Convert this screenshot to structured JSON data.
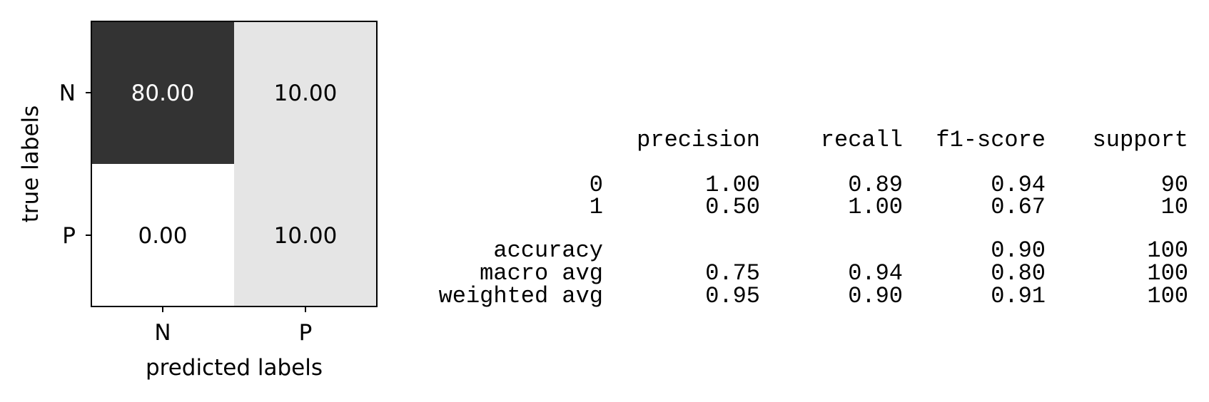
{
  "chart_data": [
    {
      "type": "heatmap",
      "title": "",
      "xlabel": "predicted labels",
      "ylabel": "true labels",
      "x_categories": [
        "N",
        "P"
      ],
      "y_categories": [
        "N",
        "P"
      ],
      "values": [
        [
          80.0,
          10.0
        ],
        [
          0.0,
          10.0
        ]
      ],
      "value_labels": [
        [
          "80.00",
          "10.00"
        ],
        [
          "0.00",
          "10.00"
        ]
      ],
      "colormap": "greys",
      "colors": {
        "dark": "#333333",
        "light": "#e5e5e5",
        "white": "#ffffff",
        "text_on_dark": "#ffffff",
        "text_on_light": "#000000"
      }
    },
    {
      "type": "table",
      "columns": [
        "precision",
        "recall",
        "f1-score",
        "support"
      ],
      "rows": [
        {
          "label": "0",
          "precision": "1.00",
          "recall": "0.89",
          "f1": "0.94",
          "support": "90"
        },
        {
          "label": "1",
          "precision": "0.50",
          "recall": "1.00",
          "f1": "0.67",
          "support": "10"
        },
        {
          "label": "accuracy",
          "precision": "",
          "recall": "",
          "f1": "0.90",
          "support": "100"
        },
        {
          "label": "macro avg",
          "precision": "0.75",
          "recall": "0.94",
          "f1": "0.80",
          "support": "100"
        },
        {
          "label": "weighted avg",
          "precision": "0.95",
          "recall": "0.90",
          "f1": "0.91",
          "support": "100"
        }
      ]
    }
  ]
}
